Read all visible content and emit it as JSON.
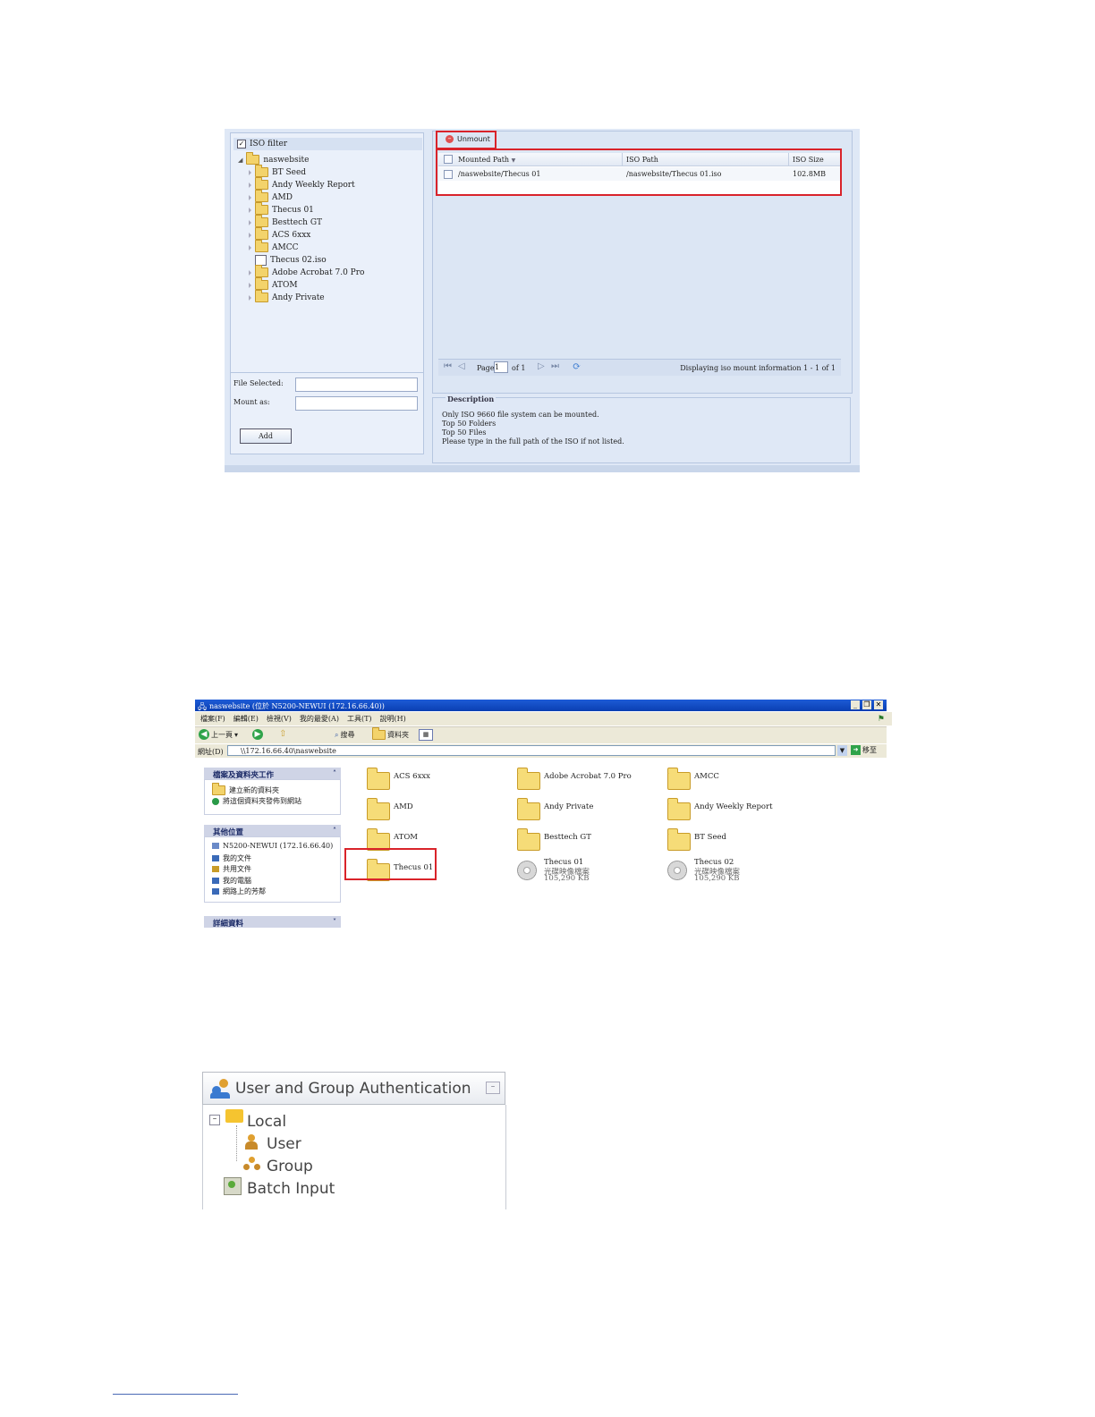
{
  "iso_panel": {
    "filter_label": "ISO filter",
    "root_folder": "naswebsite",
    "tree_items": [
      {
        "label": "BT Seed",
        "type": "folder"
      },
      {
        "label": "Andy Weekly Report",
        "type": "folder"
      },
      {
        "label": "AMD",
        "type": "folder"
      },
      {
        "label": "Thecus 01",
        "type": "folder"
      },
      {
        "label": "Besttech GT",
        "type": "folder"
      },
      {
        "label": "ACS 6xxx",
        "type": "folder"
      },
      {
        "label": "AMCC",
        "type": "folder"
      },
      {
        "label": "Thecus 02.iso",
        "type": "file"
      },
      {
        "label": "Adobe Acrobat 7.0 Pro",
        "type": "folder"
      },
      {
        "label": "ATOM",
        "type": "folder"
      },
      {
        "label": "Andy Private",
        "type": "folder"
      }
    ],
    "file_selected_label": "File Selected:",
    "mount_as_label": "Mount as:",
    "add_button": "Add",
    "unmount_button": "Unmount",
    "columns": [
      "Mounted Path",
      "ISO Path",
      "ISO Size"
    ],
    "rows": [
      {
        "mounted_path": "/naswebsite/Thecus 01",
        "iso_path": "/naswebsite/Thecus 01.iso",
        "iso_size": "102.8MB"
      }
    ],
    "pager": {
      "page_label": "Page",
      "page_value": "1",
      "of_label": "of 1",
      "display_info": "Displaying iso mount information 1 - 1 of 1"
    },
    "description_title": "Description",
    "description_lines": [
      "Only ISO 9660 file system can be mounted.",
      "Top 50 Folders",
      "Top 50 Files",
      "Please type in the full path of the ISO if not listed."
    ]
  },
  "explorer": {
    "title": "naswebsite (位於 N5200-NEWUI (172.16.66.40))",
    "menu": [
      "檔案(F)",
      "編輯(E)",
      "檢視(V)",
      "我的最愛(A)",
      "工具(T)",
      "說明(H)"
    ],
    "toolbar": {
      "back": "上一頁",
      "search": "搜尋",
      "folders": "資料夾"
    },
    "address_label": "網址(D)",
    "address_value": "\\\\172.16.66.40\\naswebsite",
    "go_label": "移至",
    "task_panel": {
      "title": "檔案及資料夾工作",
      "links": [
        "建立新的資料夾",
        "將這個資料夾發佈到網站"
      ]
    },
    "other_places": {
      "title": "其他位置",
      "links": [
        "N5200-NEWUI (172.16.66.40)",
        "我的文件",
        "共用文件",
        "我的電腦",
        "網路上的芳鄰"
      ]
    },
    "details_title": "詳細資料",
    "items": [
      {
        "name": "ACS 6xxx",
        "type": "folder"
      },
      {
        "name": "Adobe Acrobat 7.0 Pro",
        "type": "folder"
      },
      {
        "name": "AMCC",
        "type": "folder"
      },
      {
        "name": "AMD",
        "type": "folder"
      },
      {
        "name": "Andy Private",
        "type": "folder"
      },
      {
        "name": "Andy Weekly Report",
        "type": "folder"
      },
      {
        "name": "ATOM",
        "type": "folder"
      },
      {
        "name": "Besttech GT",
        "type": "folder"
      },
      {
        "name": "BT Seed",
        "type": "folder"
      },
      {
        "name": "Thecus 01",
        "type": "folder"
      },
      {
        "name": "Thecus 01",
        "type": "iso",
        "kind": "光碟映像檔案",
        "size": "105,290 KB"
      },
      {
        "name": "Thecus 02",
        "type": "iso",
        "kind": "光碟映像檔案",
        "size": "105,290 KB"
      }
    ]
  },
  "auth_tree": {
    "title": "User and Group Authentication",
    "local": "Local",
    "user": "User",
    "group": "Group",
    "batch": "Batch Input"
  },
  "colors": {
    "highlight_red": "#d9232a",
    "panel_blue": "#dfe8f6",
    "xp_title_blue": "#0a3fb2"
  }
}
